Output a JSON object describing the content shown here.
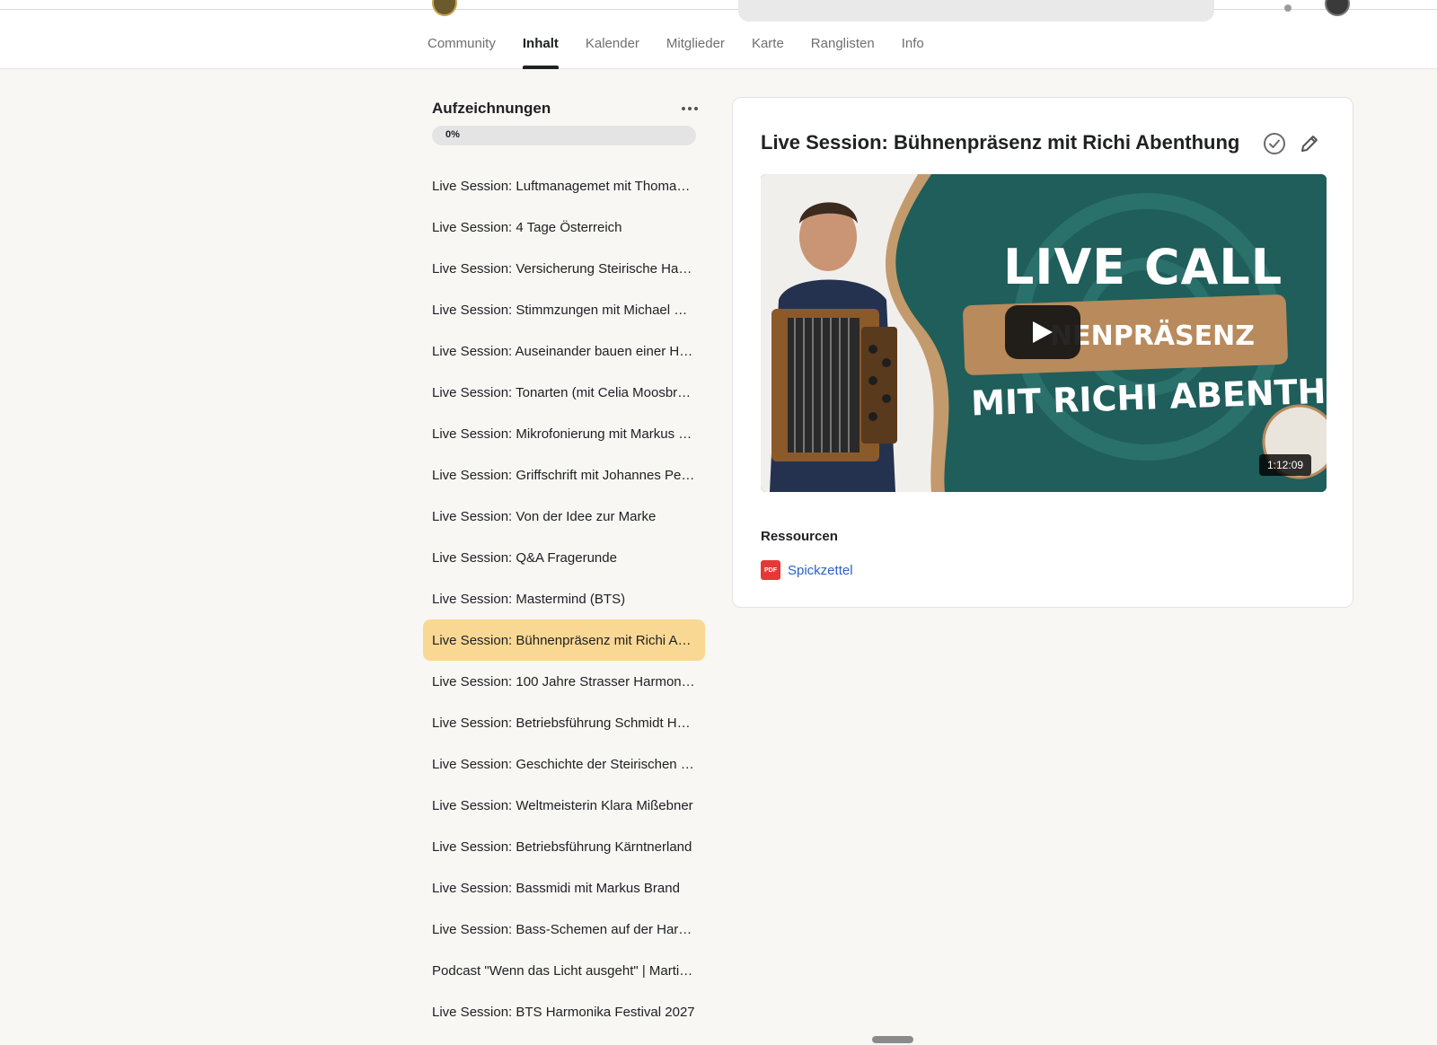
{
  "nav": {
    "tabs": [
      {
        "label": "Community"
      },
      {
        "label": "Inhalt",
        "active": true
      },
      {
        "label": "Kalender"
      },
      {
        "label": "Mitglieder"
      },
      {
        "label": "Karte"
      },
      {
        "label": "Ranglisten"
      },
      {
        "label": "Info"
      }
    ]
  },
  "sidebar": {
    "title": "Aufzeichnungen",
    "progress": {
      "label": "0%",
      "value_percent": 0
    },
    "lessons": [
      "Live Session: Luftmanagemet mit Thoma…",
      "Live Session: 4 Tage Österreich",
      "Live Session: Versicherung Steirische Har…",
      "Live Session: Stimmzungen mit Michael S…",
      "Live Session: Auseinander bauen einer Ha…",
      "Live Session: Tonarten (mit Celia Moosbr…",
      "Live Session: Mikrofonierung mit Markus …",
      "Live Session: Griffschrift mit Johannes Pe…",
      "Live Session: Von der Idee zur Marke",
      "Live Session: Q&A Fragerunde",
      "Live Session: Mastermind (BTS)",
      "Live Session: Bühnenpräsenz mit Richi Ab…",
      "Live Session: 100 Jahre Strasser Harmoni…",
      "Live Session: Betriebsführung Schmidt Ha…",
      "Live Session: Geschichte der Steirischen …",
      "Live Session: Weltmeisterin Klara Mißebner",
      "Live Session: Betriebsführung Kärntnerland",
      "Live Session: Bassmidi mit Markus Brand",
      "Live Session: Bass-Schemen auf der Har…",
      "Podcast \"Wenn das Licht ausgeht\" | Marti…",
      "Live Session: BTS Harmonika Festival 2027"
    ],
    "active_index": 11
  },
  "main": {
    "title": "Live Session: Bühnenpräsenz mit Richi Abenthung",
    "video": {
      "thumb_line1": "LIVE CALL",
      "thumb_line2": "NENPRÄSENZ",
      "thumb_line3": "MIT RICHI ABENTHUNG",
      "duration": "1:12:09"
    },
    "resources": {
      "title": "Ressourcen",
      "items": [
        {
          "icon_text": "PDF",
          "label": "Spickzettel"
        }
      ]
    }
  },
  "colors": {
    "accent_highlight": "#f9d893",
    "link": "#2b62c9",
    "video_bg": "#1f5e5a",
    "pdf_red": "#e53935"
  }
}
